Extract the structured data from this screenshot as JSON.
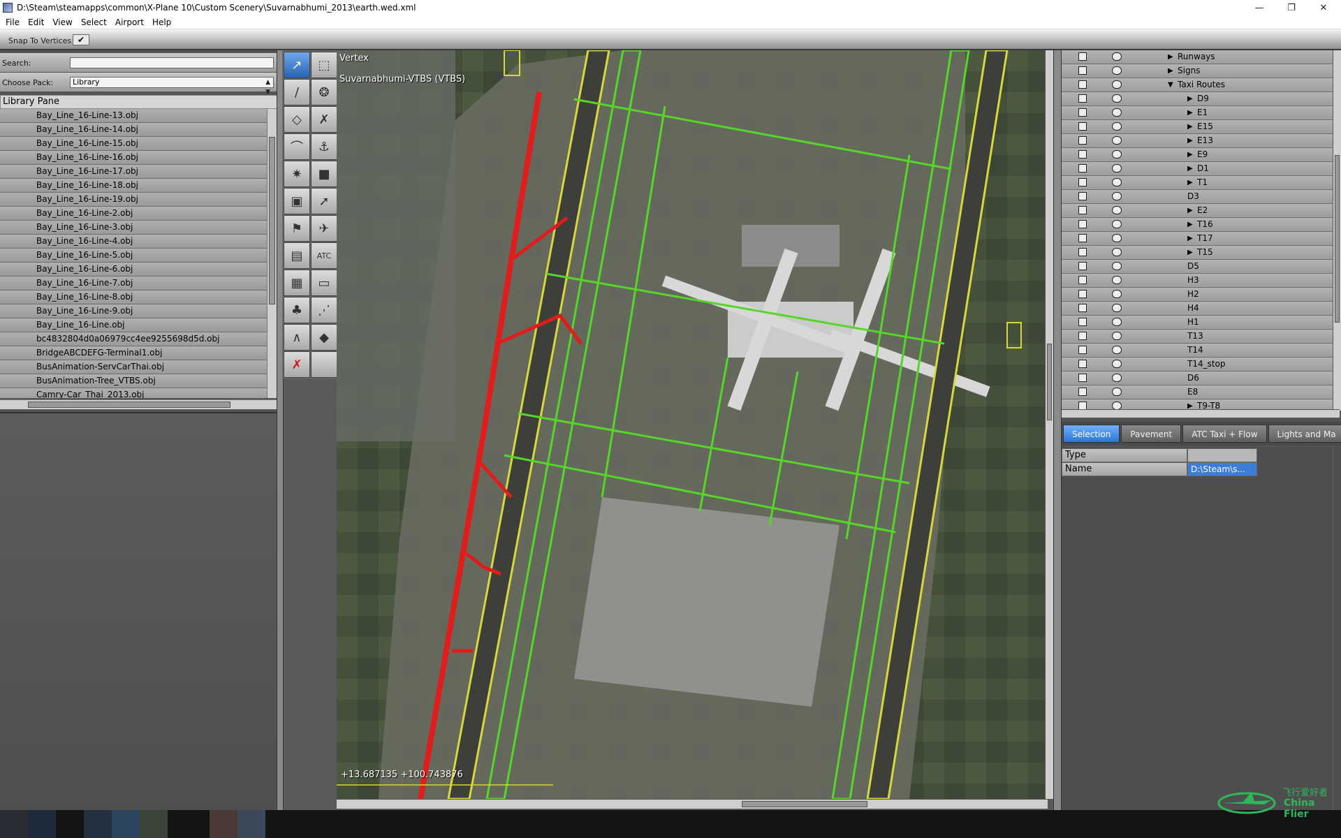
{
  "window": {
    "title": "D:\\Steam\\steamapps\\common\\X-Plane 10\\Custom Scenery\\Suvarnabhumi_2013\\earth.wed.xml",
    "minimize": "—",
    "maximize": "❐",
    "close": "✕"
  },
  "menu": [
    "File",
    "Edit",
    "View",
    "Select",
    "Airport",
    "Help"
  ],
  "snap": {
    "label": "Snap To Vertices",
    "checked": "✔"
  },
  "left": {
    "search_label": "Search:",
    "search_value": "",
    "pack_label": "Choose Pack:",
    "pack_value": "Library",
    "pane_title": "Library Pane",
    "items": [
      "Bay_Line_16-Line-13.obj",
      "Bay_Line_16-Line-14.obj",
      "Bay_Line_16-Line-15.obj",
      "Bay_Line_16-Line-16.obj",
      "Bay_Line_16-Line-17.obj",
      "Bay_Line_16-Line-18.obj",
      "Bay_Line_16-Line-19.obj",
      "Bay_Line_16-Line-2.obj",
      "Bay_Line_16-Line-3.obj",
      "Bay_Line_16-Line-4.obj",
      "Bay_Line_16-Line-5.obj",
      "Bay_Line_16-Line-6.obj",
      "Bay_Line_16-Line-7.obj",
      "Bay_Line_16-Line-8.obj",
      "Bay_Line_16-Line-9.obj",
      "Bay_Line_16-Line.obj",
      "bc4832804d0a06979cc4ee9255698d5d.obj",
      "BridgeABCDEFG-Terminal1.obj",
      "BusAnimation-ServCarThai.obj",
      "BusAnimation-Tree_VTBS.obj",
      "Camry-Car_Thai_2013.obj"
    ]
  },
  "tools": [
    {
      "icon": "vertex-tool-icon",
      "glyph": "↗",
      "active": true
    },
    {
      "icon": "marquee-tool-icon",
      "glyph": "⬚"
    },
    {
      "icon": "runway-tool-icon",
      "glyph": "∕"
    },
    {
      "icon": "helipad-tool-icon",
      "glyph": "❂"
    },
    {
      "icon": "taxiway-tool-icon",
      "glyph": "◇"
    },
    {
      "icon": "boundary-tool-icon",
      "glyph": "✗"
    },
    {
      "icon": "line-tool-icon",
      "glyph": "⌒"
    },
    {
      "icon": "windsock-tool-icon",
      "glyph": "⚓"
    },
    {
      "icon": "light-tool-icon",
      "glyph": "✷"
    },
    {
      "icon": "sign-tool-icon",
      "glyph": "■"
    },
    {
      "icon": "object-tool-icon",
      "glyph": "▣"
    },
    {
      "icon": "beacon-tool-icon",
      "glyph": "➚"
    },
    {
      "icon": "startup-tool-icon",
      "glyph": "⚑"
    },
    {
      "icon": "aircraft-tool-icon",
      "glyph": "✈"
    },
    {
      "icon": "facade-tool-icon",
      "glyph": "▤"
    },
    {
      "icon": "atc-tool-icon",
      "glyph": "ATC"
    },
    {
      "icon": "building-tool-icon",
      "glyph": "▦"
    },
    {
      "icon": "polygon-tool-icon",
      "glyph": "▭"
    },
    {
      "icon": "forest-tool-icon",
      "glyph": "♣"
    },
    {
      "icon": "string-tool-icon",
      "glyph": "⋰"
    },
    {
      "icon": "linestring-tool-icon",
      "glyph": "∧"
    },
    {
      "icon": "draped-polygon-tool-icon",
      "glyph": "◆"
    },
    {
      "icon": "delete-tool-icon",
      "glyph": "✗",
      "x": true
    },
    {
      "icon": "empty-tool-icon",
      "glyph": ""
    }
  ],
  "map": {
    "tool_name": "Vertex",
    "airport": "Suvarnabhumi-VTBS (VTBS)",
    "coords": "+13.687135 +100.743876"
  },
  "hierarchy": [
    {
      "name": "Runways",
      "indent": 1,
      "expander": "▶"
    },
    {
      "name": "Signs",
      "indent": 1,
      "expander": "▶"
    },
    {
      "name": "Taxi Routes",
      "indent": 1,
      "expander": "▼"
    },
    {
      "name": "D9",
      "indent": 2,
      "expander": "▶"
    },
    {
      "name": "E1",
      "indent": 2,
      "expander": "▶"
    },
    {
      "name": "E15",
      "indent": 2,
      "expander": "▶"
    },
    {
      "name": "E13",
      "indent": 2,
      "expander": "▶"
    },
    {
      "name": "E9",
      "indent": 2,
      "expander": "▶"
    },
    {
      "name": "D1",
      "indent": 2,
      "expander": "▶"
    },
    {
      "name": "T1",
      "indent": 2,
      "expander": "▶"
    },
    {
      "name": "D3",
      "indent": 2,
      "expander": ""
    },
    {
      "name": "E2",
      "indent": 2,
      "expander": "▶"
    },
    {
      "name": "T16",
      "indent": 2,
      "expander": "▶"
    },
    {
      "name": "T17",
      "indent": 2,
      "expander": "▶"
    },
    {
      "name": "T15",
      "indent": 2,
      "expander": "▶"
    },
    {
      "name": "D5",
      "indent": 2,
      "expander": ""
    },
    {
      "name": "H3",
      "indent": 2,
      "expander": ""
    },
    {
      "name": "H2",
      "indent": 2,
      "expander": ""
    },
    {
      "name": "H4",
      "indent": 2,
      "expander": ""
    },
    {
      "name": "H1",
      "indent": 2,
      "expander": ""
    },
    {
      "name": "T13",
      "indent": 2,
      "expander": ""
    },
    {
      "name": "T14",
      "indent": 2,
      "expander": ""
    },
    {
      "name": "T14_stop",
      "indent": 2,
      "expander": ""
    },
    {
      "name": "D6",
      "indent": 2,
      "expander": ""
    },
    {
      "name": "E8",
      "indent": 2,
      "expander": ""
    },
    {
      "name": "T9-T8",
      "indent": 2,
      "expander": "▶"
    }
  ],
  "tabs": [
    "Selection",
    "Pavement",
    "ATC Taxi + Flow",
    "Lights and Ma"
  ],
  "properties": [
    {
      "key": "Type",
      "value": ""
    },
    {
      "key": "Name",
      "value": "D:\\Steam\\s..."
    }
  ],
  "watermark": {
    "cn": "飞行爱好者",
    "en": "China Flier"
  },
  "colors": {
    "selection_blue": "#3b7dd8",
    "taxi_green": "#57d62a",
    "runway_red": "#e21b1b",
    "taxi_yellow": "#d8d83a"
  }
}
